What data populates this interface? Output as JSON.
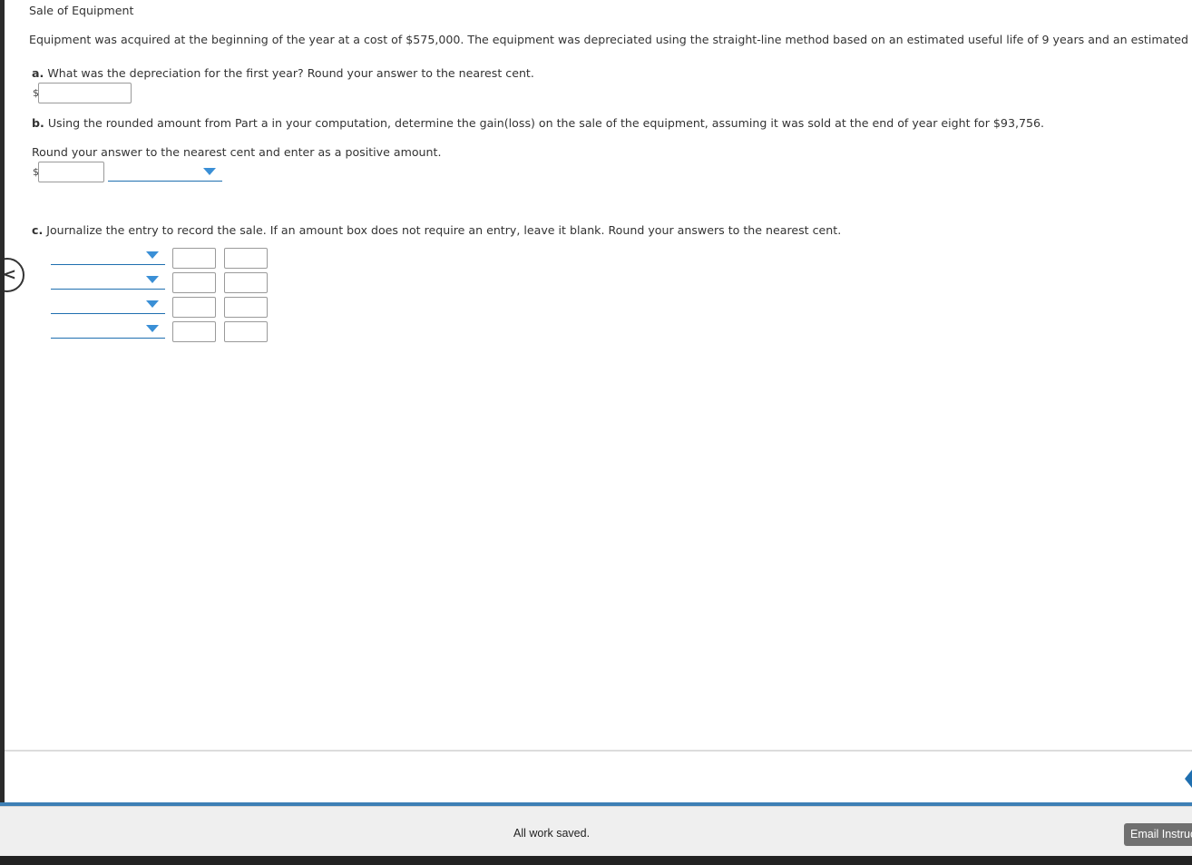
{
  "problem": {
    "title": "Sale of Equipment",
    "description": "Equipment was acquired at the beginning of the year at a cost of $575,000. The equipment was depreciated using the straight-line method based on an estimated useful life of 9 years and an estimated residual v"
  },
  "part_a": {
    "letter": "a.",
    "question": "What was the depreciation for the first year? Round your answer to the nearest cent.",
    "currency": "$",
    "value": ""
  },
  "part_b": {
    "letter": "b.",
    "question": "Using the rounded amount from Part a in your computation, determine the gain(loss) on the sale of the equipment, assuming it was sold at the end of year eight for $93,756.",
    "instruction": "Round your answer to the nearest cent and enter as a positive amount.",
    "currency": "$",
    "value": "",
    "selected_option": ""
  },
  "part_c": {
    "letter": "c.",
    "question": "Journalize the entry to record the sale. If an amount box does not require an entry, leave it blank. Round your answers to the nearest cent.",
    "rows": [
      {
        "account": "",
        "debit": "",
        "credit": ""
      },
      {
        "account": "",
        "debit": "",
        "credit": ""
      },
      {
        "account": "",
        "debit": "",
        "credit": ""
      },
      {
        "account": "",
        "debit": "",
        "credit": ""
      }
    ]
  },
  "icons": {
    "prev": "chevron-left-icon",
    "next": "chevron-right-icon",
    "dropdown": "caret-down-icon"
  },
  "colors": {
    "accent": "#1f6fb0",
    "caret": "#3a8fd6",
    "email_button": "#707070"
  },
  "footer": {
    "status": "All work saved.",
    "email_label": "Email Instructor"
  }
}
